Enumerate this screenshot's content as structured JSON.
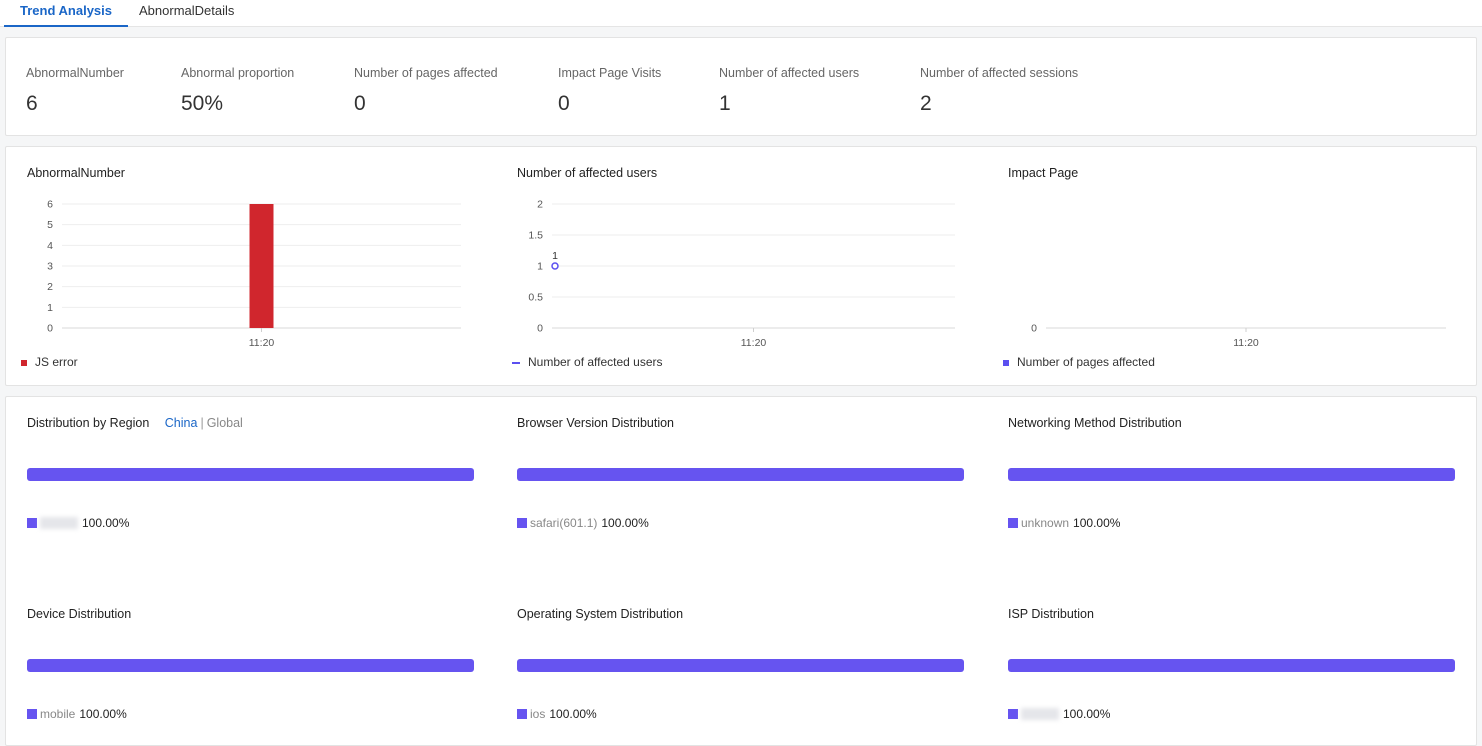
{
  "tabs": [
    {
      "label": "Trend Analysis",
      "active": true
    },
    {
      "label": "AbnormalDetails",
      "active": false
    }
  ],
  "kpis": [
    {
      "label": "AbnormalNumber",
      "value": "6"
    },
    {
      "label": "Abnormal proportion",
      "value": "50%"
    },
    {
      "label": "Number of pages affected",
      "value": "0"
    },
    {
      "label": "Impact Page Visits",
      "value": "0"
    },
    {
      "label": "Number of affected users",
      "value": "1"
    },
    {
      "label": "Number of affected sessions",
      "value": "2"
    }
  ],
  "chart_data": [
    {
      "type": "bar",
      "title": "AbnormalNumber",
      "categories": [
        "11:20"
      ],
      "series": [
        {
          "name": "JS error",
          "values": [
            6
          ],
          "color": "#d0262d"
        }
      ],
      "yticks": [
        "0",
        "1",
        "2",
        "3",
        "4",
        "5",
        "6"
      ],
      "ylim": [
        0,
        6
      ],
      "grid": true,
      "legend": "bottom-left"
    },
    {
      "type": "line",
      "title": "Number of affected users",
      "categories": [
        "11:20"
      ],
      "series": [
        {
          "name": "Number of affected users",
          "values": [
            1
          ],
          "color": "#5b4ff0"
        }
      ],
      "data_labels": [
        "1"
      ],
      "yticks": [
        "0",
        "0.5",
        "1",
        "1.5",
        "2"
      ],
      "ylim": [
        0,
        2
      ],
      "grid": true,
      "legend": "bottom-left"
    },
    {
      "type": "bar",
      "title": "Impact Page",
      "categories": [
        "11:20"
      ],
      "series": [
        {
          "name": "Number of pages affected",
          "values": [
            0
          ],
          "color": "#5b4ff0"
        }
      ],
      "yticks": [
        "0"
      ],
      "grid": false,
      "legend": "bottom-left"
    }
  ],
  "distributions": [
    {
      "title": "Distribution by Region",
      "toggle": {
        "china": "China",
        "separator": "|",
        "global": "Global"
      },
      "name": "",
      "redacted": true,
      "percent": "100.00%"
    },
    {
      "title": "Browser Version Distribution",
      "name": "safari(601.1)",
      "redacted": false,
      "percent": "100.00%"
    },
    {
      "title": "Networking Method Distribution",
      "name": "unknown",
      "redacted": false,
      "percent": "100.00%"
    },
    {
      "title": "Device Distribution",
      "name": "mobile",
      "redacted": false,
      "percent": "100.00%"
    },
    {
      "title": "Operating System Distribution",
      "name": "ios",
      "redacted": false,
      "percent": "100.00%"
    },
    {
      "title": "ISP Distribution",
      "name": "",
      "redacted": true,
      "percent": "100.00%"
    }
  ],
  "colors": {
    "accent": "#1a66c7",
    "bar_error": "#d0262d",
    "series": "#5b4ff0",
    "dist_bar": "#6654f0"
  }
}
